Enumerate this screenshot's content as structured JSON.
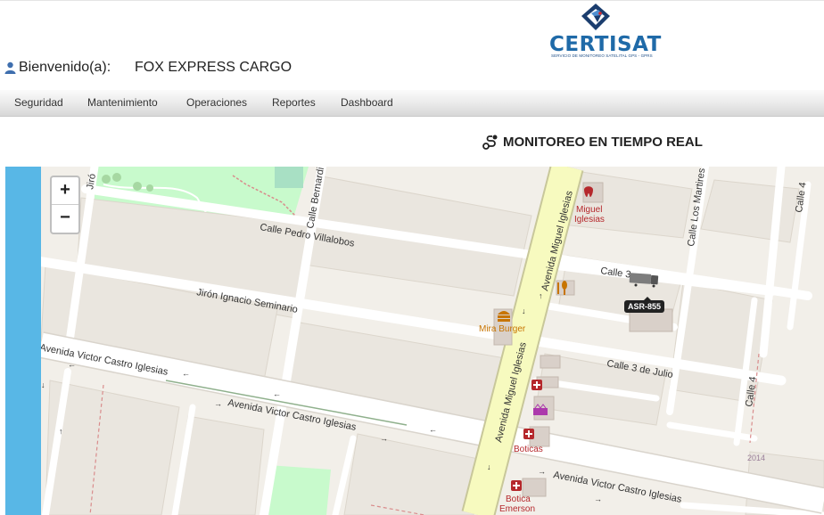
{
  "header": {
    "welcome_label": "Bienvenido(a):",
    "company_name": "FOX EXPRESS CARGO",
    "logo_text_certi": "CERTI",
    "logo_text_sat": "SAT",
    "logo_tagline": "SERVICIO DE MONITOREO SATELITAL GPS - GPRS"
  },
  "nav": {
    "items": [
      {
        "label": "Seguridad"
      },
      {
        "label": "Mantenimiento"
      },
      {
        "label": "Operaciones"
      },
      {
        "label": "Reportes"
      },
      {
        "label": "Dashboard"
      }
    ]
  },
  "page": {
    "title": "MONITOREO EN TIEMPO REAL"
  },
  "map": {
    "zoom_in": "+",
    "zoom_out": "−",
    "vehicle_label": "ASR-855",
    "streets": {
      "calle_pedro_villalobos": "Calle Pedro Villalobos",
      "jiron_ignacio_seminario": "Jirón Ignacio Seminario",
      "avenida_victor_castro_1": "Avenida Victor Castro Iglesias",
      "avenida_victor_castro_2": "Avenida Victor Castro Iglesias",
      "avenida_victor_castro_3": "Avenida Victor Castro Iglesias",
      "avenida_miguel_iglesias_1": "Avenida Miguel Iglesias",
      "avenida_miguel_iglesias_2": "Avenida Miguel Iglesias",
      "calle_3": "Calle 3",
      "calle_3_de_julio": "Calle 3 de Julio",
      "calle_los_martires": "Calle Los Martires",
      "calle_4_a": "Calle 4",
      "calle_4_b": "Calle 4",
      "calle_bernardi": "Calle Bernardi",
      "jiron_cut": "Jiró"
    },
    "pois": {
      "miguel_iglesias": "Miguel Iglesias",
      "mira_burger": "Mira Burger",
      "boticas": "Boticas",
      "botica_emerson": "Botica Emerson",
      "year_label": "2014"
    },
    "colors": {
      "land": "#f2efe9",
      "road": "#ffffff",
      "primary_road": "#f7fabf",
      "primary_casing": "#c8c79a",
      "park": "#c8facc",
      "water": "#58b7e6",
      "poi_red": "#b5282c",
      "poi_orange": "#c77400"
    }
  }
}
